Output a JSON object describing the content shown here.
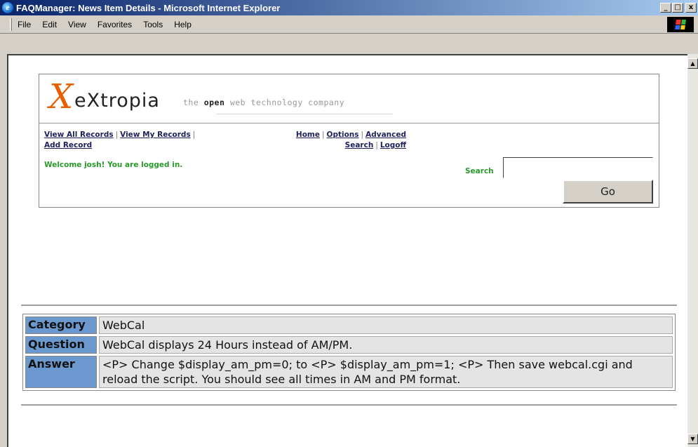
{
  "window": {
    "title": "FAQManager: News Item Details - Microsoft Internet Explorer",
    "buttons": {
      "minimize": "_",
      "maximize": "□",
      "close": "x"
    }
  },
  "menu": [
    "File",
    "Edit",
    "View",
    "Favorites",
    "Tools",
    "Help"
  ],
  "logo": {
    "mark": "X",
    "word": "eXtropia",
    "tagline_pre": "the ",
    "tagline_bold": "open",
    "tagline_post": " web technology company"
  },
  "nav": {
    "view_all": "View All Records",
    "view_my": "View My Records",
    "add": "Add Record",
    "home": "Home",
    "options": "Options",
    "advanced": "Advanced",
    "search": "Search",
    "logoff": "Logoff",
    "sep": "|"
  },
  "welcome": "Welcome josh! You are logged in.",
  "search": {
    "label": "Search",
    "value": "",
    "button": "Go"
  },
  "details": {
    "category_label": "Category",
    "category_value": "WebCal",
    "question_label": "Question",
    "question_value": "WebCal displays 24 Hours instead of AM/PM.",
    "answer_label": "Answer",
    "answer_value": "<P> Change $display_am_pm=0; to <P> $display_am_pm=1; <P> Then save webcal.cgi and reload the script. You should see all times in AM and PM format."
  },
  "scrollbar": {
    "up": "▲",
    "down": "▼"
  }
}
